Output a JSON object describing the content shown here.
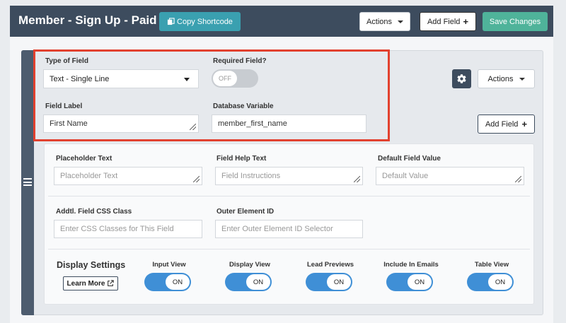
{
  "header": {
    "title": "Member - Sign Up - Paid",
    "copy_shortcode": "Copy Shortcode",
    "actions": "Actions",
    "add_field": "Add Field",
    "save_changes": "Save Changes"
  },
  "field_editor": {
    "type_label": "Type of Field",
    "type_value": "Text - Single Line",
    "required_label": "Required Field?",
    "required_toggle": "OFF",
    "field_label_label": "Field Label",
    "field_label_value": "First Name",
    "db_var_label": "Database Variable",
    "db_var_value": "member_first_name",
    "actions": "Actions",
    "add_field": "Add Field"
  },
  "advanced": {
    "placeholder_label": "Placeholder Text",
    "placeholder_ph": "Placeholder Text",
    "help_label": "Field Help Text",
    "help_ph": "Field Instructions",
    "default_label": "Default Field Value",
    "default_ph": "Default Value",
    "css_label": "Addtl. Field CSS Class",
    "css_ph": "Enter CSS Classes for This Field",
    "outer_id_label": "Outer Element ID",
    "outer_id_ph": "Enter Outer Element ID Selector"
  },
  "display_settings": {
    "title": "Display Settings",
    "learn_more": "Learn More",
    "toggles": [
      {
        "label": "Input View",
        "state": "ON"
      },
      {
        "label": "Display View",
        "state": "ON"
      },
      {
        "label": "Lead Previews",
        "state": "ON"
      },
      {
        "label": "Include In Emails",
        "state": "ON"
      },
      {
        "label": "Table View",
        "state": "ON"
      }
    ]
  },
  "colors": {
    "header_bg": "#3d4c5e",
    "accent_teal": "#3aa0b0",
    "save_green": "#4fb39a",
    "toggle_on": "#3f8fd6",
    "highlight_red": "#e2412f"
  }
}
